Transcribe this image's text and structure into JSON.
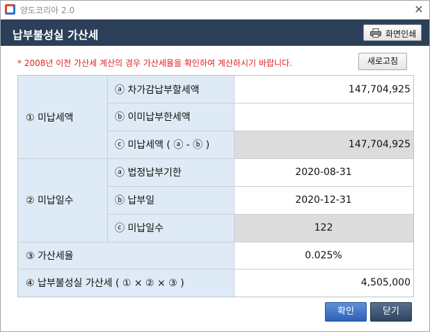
{
  "window": {
    "app_title": "양도코리아 2.0",
    "close_glyph": "✕"
  },
  "header": {
    "title": "납부불성실 가산세",
    "print_label": "화면인쇄"
  },
  "notice": {
    "text": "* 2008년 이전 가산세 계산의 경우 가산세율을 확인하여 계산하시기 바랍니다.",
    "color": "#e02020"
  },
  "refresh_label": "새로고침",
  "sections": {
    "unpaid_tax": {
      "label": "① 미납세액",
      "rows": [
        {
          "label": "ⓐ 차가감납부할세액",
          "value": "147,704,925"
        },
        {
          "label": "ⓑ 이미납부한세액",
          "value": ""
        },
        {
          "label": "ⓒ 미납세액 ( ⓐ - ⓑ )",
          "value": "147,704,925"
        }
      ]
    },
    "unpaid_days": {
      "label": "② 미납일수",
      "rows": [
        {
          "label": "ⓐ 법정납부기한",
          "value": "2020-08-31"
        },
        {
          "label": "ⓑ 납부일",
          "value": "2020-12-31"
        },
        {
          "label": "ⓒ 미납일수",
          "value": "122"
        }
      ]
    },
    "rate": {
      "label": "③ 가산세율",
      "value": "0.025%"
    },
    "penalty": {
      "label": "④ 납부불성실 가산세 ( ① × ② × ③ )",
      "value": "4,505,000"
    }
  },
  "buttons": {
    "ok": "확인",
    "close": "닫기"
  },
  "colors": {
    "header_bg": "#2b3f58",
    "label_bg": "#deeaf5",
    "readonly_bg": "#dcdcdc",
    "ok_button": "#2e61b8",
    "close_button": "#2f4560"
  }
}
